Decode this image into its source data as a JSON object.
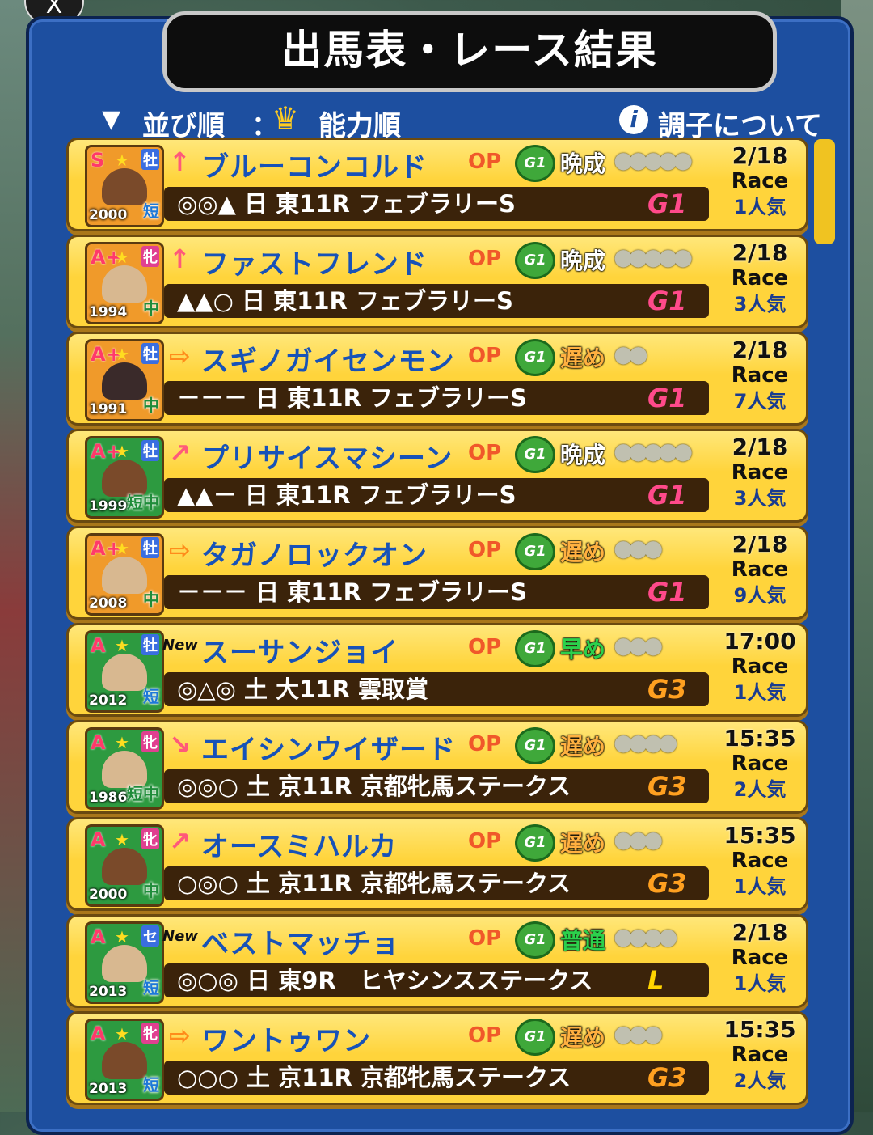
{
  "header": {
    "close": "X",
    "title": "出馬表・レース結果",
    "sort_icon": "▼",
    "sort_label": "並び順",
    "colon": "：",
    "sort_value": "能力順",
    "info_label": "調子について"
  },
  "horses": [
    {
      "grade": "S",
      "sex": "牡",
      "year": "2000",
      "dist": "短",
      "arrow": "↑",
      "name": "ブルーコンコルド",
      "class": "OP",
      "badge": "G1",
      "growth": "晩成",
      "condition": "●●●●●",
      "marks": "◎◎▲",
      "day": "日",
      "race": "東11R フェブラリーS",
      "race_grade": "G1",
      "date": "2/18",
      "race_word": "Race",
      "pop": "1人気"
    },
    {
      "grade": "A+",
      "sex": "牝",
      "year": "1994",
      "dist": "中",
      "arrow": "↑",
      "name": "ファストフレンド",
      "class": "OP",
      "badge": "G1",
      "growth": "晩成",
      "condition": "●●●●●",
      "marks": "▲▲○",
      "day": "日",
      "race": "東11R フェブラリーS",
      "race_grade": "G1",
      "date": "2/18",
      "race_word": "Race",
      "pop": "3人気"
    },
    {
      "grade": "A+",
      "sex": "牡",
      "year": "1991",
      "dist": "中",
      "arrow": "⇨",
      "name": "スギノガイセンモン",
      "class": "OP",
      "badge": "G1",
      "growth": "遅め",
      "condition": "●●",
      "marks": "－－－",
      "day": "日",
      "race": "東11R フェブラリーS",
      "race_grade": "G1",
      "date": "2/18",
      "race_word": "Race",
      "pop": "7人気"
    },
    {
      "grade": "A+",
      "sex": "牡",
      "year": "1999",
      "dist": "短中",
      "arrow": "↗",
      "name": "プリサイスマシーン",
      "class": "OP",
      "badge": "G1",
      "growth": "晩成",
      "condition": "●●●●●",
      "marks": "▲▲－",
      "day": "日",
      "race": "東11R フェブラリーS",
      "race_grade": "G1",
      "date": "2/18",
      "race_word": "Race",
      "pop": "3人気"
    },
    {
      "grade": "A+",
      "sex": "牡",
      "year": "2008",
      "dist": "中",
      "arrow": "⇨",
      "name": "タガノロックオン",
      "class": "OP",
      "badge": "G1",
      "growth": "遅め",
      "condition": "●●●",
      "marks": "－－－",
      "day": "日",
      "race": "東11R フェブラリーS",
      "race_grade": "G1",
      "date": "2/18",
      "race_word": "Race",
      "pop": "9人気"
    },
    {
      "grade": "A",
      "sex": "牡",
      "year": "2012",
      "dist": "短",
      "arrow": "New",
      "name": "スーサンジョイ",
      "class": "OP",
      "badge": "G1",
      "growth": "早め",
      "condition": "●●●",
      "marks": "◎△◎",
      "day": "土",
      "race": "大11R 雲取賞",
      "race_grade": "G3",
      "date": "17:00",
      "race_word": "Race",
      "pop": "1人気"
    },
    {
      "grade": "A",
      "sex": "牝",
      "year": "1986",
      "dist": "短中",
      "arrow": "↘",
      "name": "エイシンウイザード",
      "class": "OP",
      "badge": "G1",
      "growth": "遅め",
      "condition": "●●●●",
      "marks": "◎◎○",
      "day": "土",
      "race": "京11R 京都牝馬ステークス",
      "race_grade": "G3",
      "date": "15:35",
      "race_word": "Race",
      "pop": "2人気"
    },
    {
      "grade": "A",
      "sex": "牝",
      "year": "2000",
      "dist": "中",
      "arrow": "↗",
      "name": "オースミハルカ",
      "class": "OP",
      "badge": "G1",
      "growth": "遅め",
      "condition": "●●●",
      "marks": "○◎○",
      "day": "土",
      "race": "京11R 京都牝馬ステークス",
      "race_grade": "G3",
      "date": "15:35",
      "race_word": "Race",
      "pop": "1人気"
    },
    {
      "grade": "A",
      "sex": "セ",
      "year": "2013",
      "dist": "短",
      "arrow": "New",
      "name": "ベストマッチョ",
      "class": "OP",
      "badge": "G1",
      "growth": "普通",
      "condition": "●●●●",
      "marks": "◎○◎",
      "day": "日",
      "race": "東9R　ヒヤシンスステークス",
      "race_grade": "L",
      "date": "2/18",
      "race_word": "Race",
      "pop": "1人気"
    },
    {
      "grade": "A",
      "sex": "牝",
      "year": "2013",
      "dist": "短",
      "arrow": "⇨",
      "name": "ワントゥワン",
      "class": "OP",
      "badge": "G1",
      "growth": "遅め",
      "condition": "●●●",
      "marks": "○○○",
      "day": "土",
      "race": "京11R 京都牝馬ステークス",
      "race_grade": "G3",
      "date": "15:35",
      "race_word": "Race",
      "pop": "2人気"
    }
  ]
}
